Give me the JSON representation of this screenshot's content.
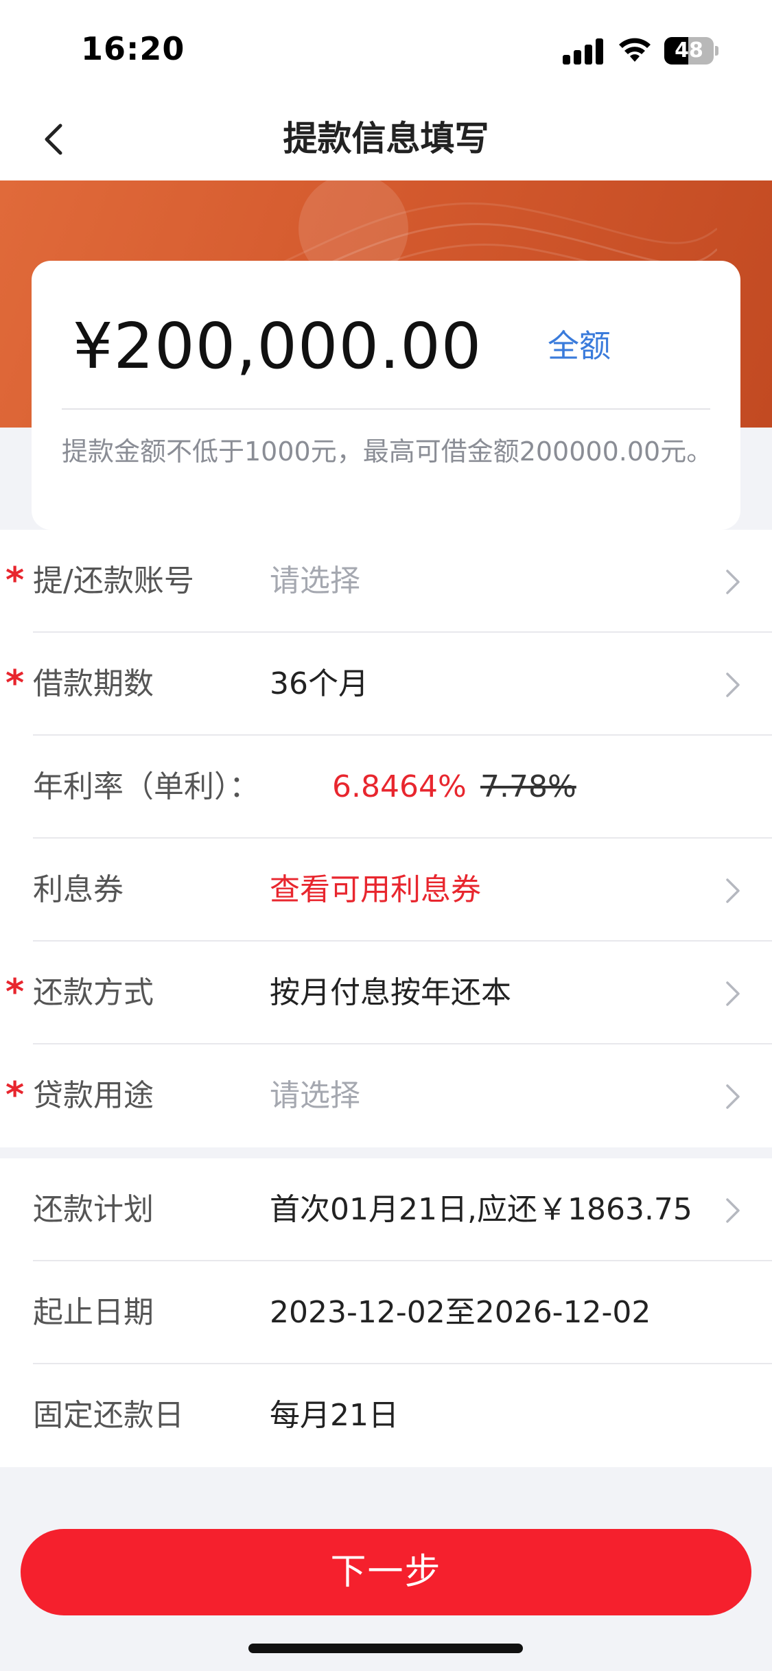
{
  "status_bar": {
    "time": "16:20",
    "battery": "48",
    "battery_level": 0.48
  },
  "nav": {
    "title": "提款信息填写",
    "back_icon": "chevron-left-icon"
  },
  "colors": {
    "accent_red": "#f5202d",
    "banner_orange": "#d45a2e",
    "link_blue": "#3a7bdb",
    "rate_red": "#e8262e"
  },
  "amount": {
    "value": "¥200,000.00",
    "full_label": "全额",
    "hint": "提款金额不低于1000元，最高可借金额200000.00元。"
  },
  "form": {
    "required_mark": "*",
    "account": {
      "label": "提/还款账号",
      "value": "请选择"
    },
    "term": {
      "label": "借款期数",
      "value": "36个月"
    },
    "rate": {
      "label": "年利率（单利）：",
      "new": "6.8464%",
      "old": "7.78%"
    },
    "coupon": {
      "label": "利息券",
      "value": "查看可用利息券"
    },
    "repay_method": {
      "label": "还款方式",
      "value": "按月付息按年还本"
    },
    "purpose": {
      "label": "贷款用途",
      "value": "请选择"
    }
  },
  "plan": {
    "schedule": {
      "label": "还款计划",
      "value": "首次01月21日,应还￥1863.75"
    },
    "dates": {
      "label": "起止日期",
      "value": "2023-12-02至2026-12-02"
    },
    "fixed_day": {
      "label": "固定还款日",
      "value": "每月21日"
    }
  },
  "footer": {
    "next_label": "下一步"
  }
}
